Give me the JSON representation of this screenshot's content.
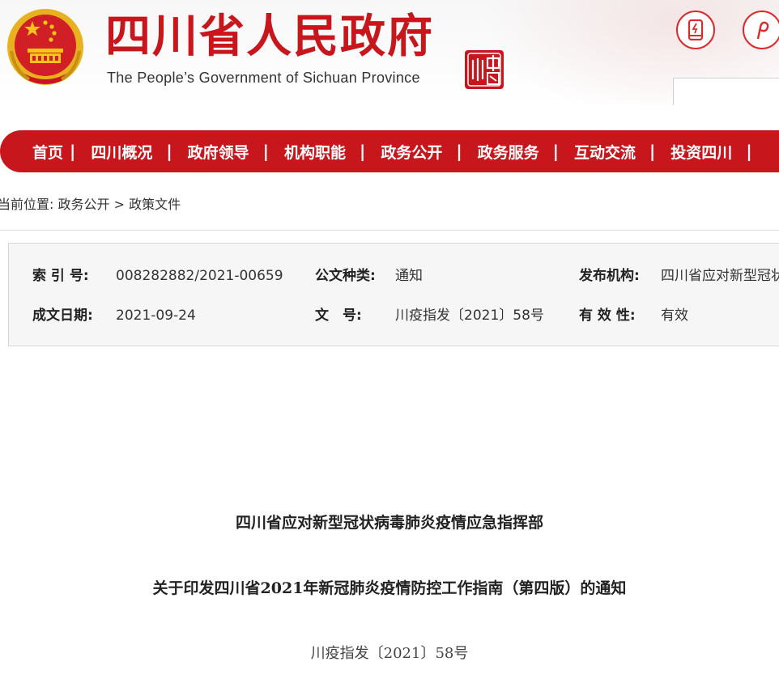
{
  "header": {
    "title": "四川省人民政府",
    "subtitle": "The People’s Government of Sichuan Province",
    "emblem_icon": "national-emblem-icon",
    "seal_icon": "sichuan-seal-icon",
    "mobile_button_icon": "mobile-phone-icon",
    "second_button_icon": "share-icon",
    "search": {
      "value": "",
      "placeholder": ""
    }
  },
  "nav": {
    "items": [
      {
        "label": "首页"
      },
      {
        "label": "四川概况"
      },
      {
        "label": "政府领导"
      },
      {
        "label": "机构职能"
      },
      {
        "label": "政务公开"
      },
      {
        "label": "政务服务"
      },
      {
        "label": "互动交流"
      },
      {
        "label": "投资四川"
      }
    ],
    "separator": "|"
  },
  "breadcrumb": {
    "prefix": "当前位置:",
    "items": [
      "政务公开",
      "政策文件"
    ],
    "separator": ">"
  },
  "info": {
    "index_label": "索 引 号:",
    "index_value": "008282882/2021-00659",
    "type_label": "公文种类:",
    "type_value": "通知",
    "issuer_label": "发布机构:",
    "issuer_value": "四川省应对新型冠状",
    "date_label": "成文日期:",
    "date_value": "2021-09-24",
    "docno_label": "文　号:",
    "docno_value": "川疫指发〔2021〕58号",
    "validity_label": "有 效 性:",
    "validity_value": "有效"
  },
  "document": {
    "org": "四川省应对新型冠状病毒肺炎疫情应急指挥部",
    "title": "关于印发四川省2021年新冠肺炎疫情防控工作指南（第四版）的通知",
    "doc_number": "川疫指发〔2021〕58号"
  },
  "colors": {
    "brand_red": "#c8161d",
    "nav_text": "#ffffff",
    "info_bg": "#f6f6f6"
  }
}
